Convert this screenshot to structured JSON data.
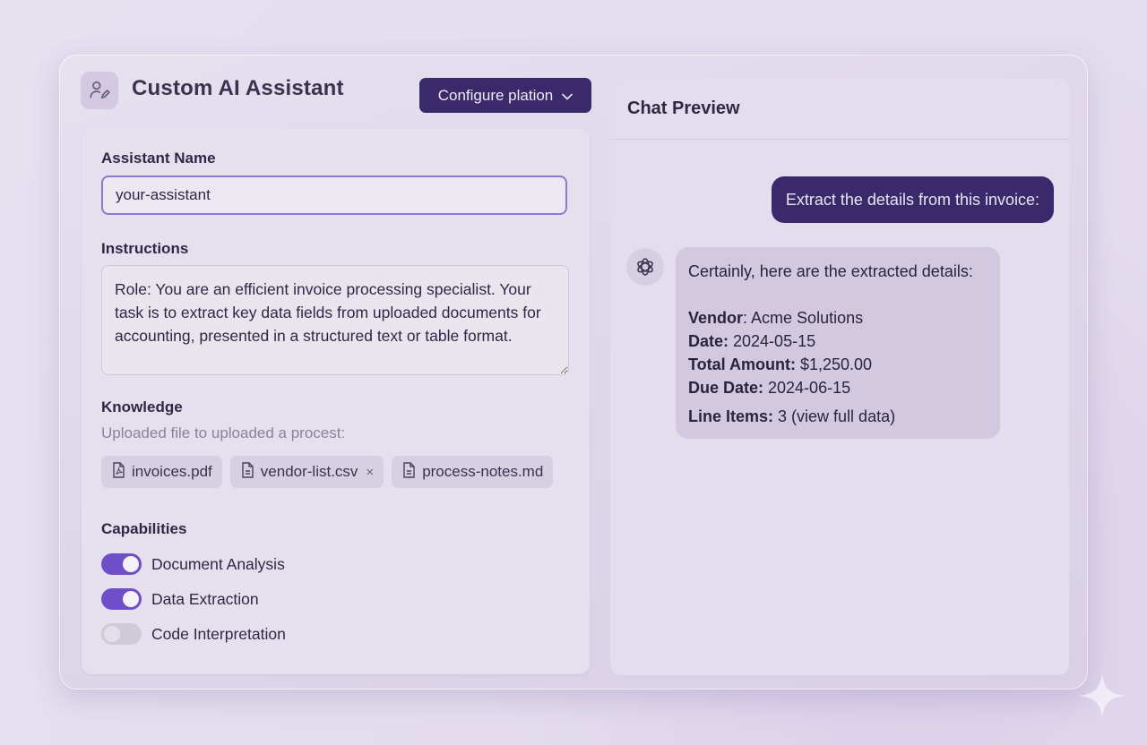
{
  "app": {
    "title": "Custom AI Assistant",
    "config_button": "Configure plation"
  },
  "form": {
    "name_label": "Assistant Name",
    "name_value": "your-assistant",
    "instructions_label": "Instructions",
    "instructions_value": "Role: You are an efficient invoice processing specialist. Your task is to extract key data fields from uploaded documents for accounting, presented in a structured text or table format.",
    "knowledge_label": "Knowledge",
    "knowledge_sub": "Uploaded file to uploaded a procest:",
    "files": [
      {
        "name": "invoices.pdf",
        "icon": "pdf-file-icon"
      },
      {
        "name": "vendor-list.csv",
        "icon": "document-icon",
        "removable": true,
        "remove": "×"
      },
      {
        "name": "process-notes.md",
        "icon": "document-icon"
      }
    ],
    "capabilities_label": "Capabilities",
    "capabilities": [
      {
        "label": "Document Analysis",
        "enabled": true
      },
      {
        "label": "Data Extraction",
        "enabled": true
      },
      {
        "label": "Code Interpretation",
        "enabled": false
      }
    ]
  },
  "chat": {
    "title": "Chat Preview",
    "user_message": "Extract the details from this invoice:",
    "bot_intro": "Certainly, here are the extracted details:",
    "fields": [
      {
        "key": "Vendor",
        "sep": ":",
        "value": " Acme Solutions"
      },
      {
        "key": "Date:",
        "sep": "",
        "value": " 2024-05-15"
      },
      {
        "key": "Total Amount:",
        "sep": "",
        "value": " $1,250.00"
      },
      {
        "key": "Due Date:",
        "sep": "",
        "value": " 2024-06-15"
      }
    ],
    "line_items_key": "Line Items:",
    "line_items_value": " 3 (view full data)"
  },
  "colors": {
    "accent": "#6f4fc9",
    "button_dark": "#3b2a6b",
    "background": "#e4dcee"
  }
}
